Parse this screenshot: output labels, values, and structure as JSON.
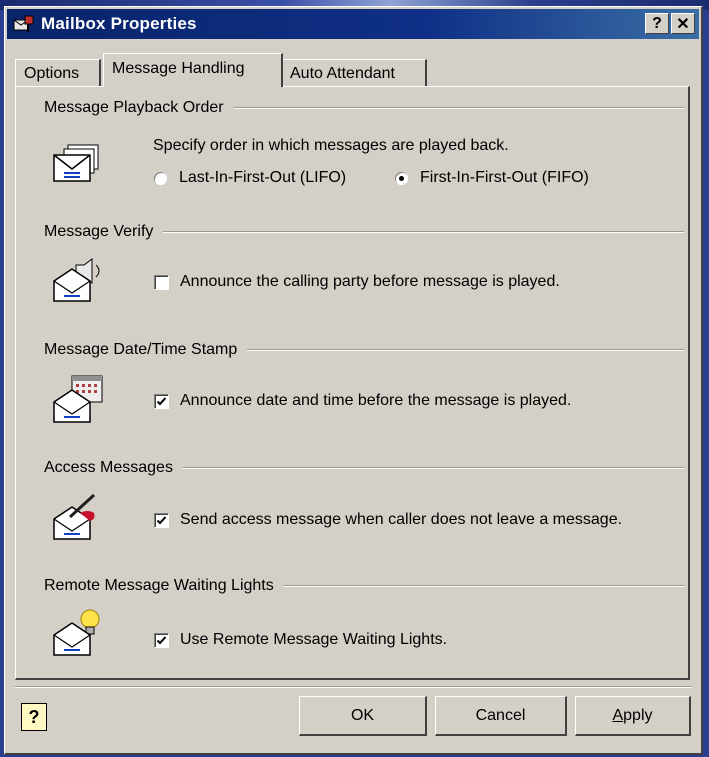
{
  "window": {
    "title": "Mailbox Properties",
    "help_glyph": "?",
    "close_glyph": "✕"
  },
  "tabs": [
    {
      "label": "Options",
      "active": false
    },
    {
      "label": "Message Handling",
      "active": true
    },
    {
      "label": "Auto Attendant",
      "active": false
    }
  ],
  "groups": {
    "playback_order": {
      "title": "Message Playback Order",
      "icon": "stacked-mail-envelope-icon",
      "description": "Specify order in which messages are played back.",
      "options": [
        {
          "label": "Last-In-First-Out (LIFO)",
          "selected": false
        },
        {
          "label": "First-In-First-Out (FIFO)",
          "selected": true
        }
      ]
    },
    "verify": {
      "title": "Message Verify",
      "icon": "speaker-envelope-icon",
      "checkbox_label": "Announce the calling party before message is played.",
      "checked": false
    },
    "date_time": {
      "title": "Message Date/Time Stamp",
      "icon": "calendar-envelope-icon",
      "checkbox_label": "Announce date and time before the message is played.",
      "checked": true
    },
    "access": {
      "title": "Access Messages",
      "icon": "pen-envelope-icon",
      "checkbox_label": "Send access message when caller does not leave a message.",
      "checked": true
    },
    "remote_lights": {
      "title": "Remote Message Waiting Lights",
      "icon": "lightbulb-envelope-icon",
      "checkbox_label": "Use Remote Message Waiting Lights.",
      "checked": true
    }
  },
  "buttons": {
    "help_glyph": "?",
    "ok": "OK",
    "cancel": "Cancel",
    "apply_first": "A",
    "apply_rest": "pply"
  },
  "colors": {
    "title_bar": "#0a246a",
    "face": "#d4d0c8",
    "highlight_bulb": "#ffe14a",
    "pen_red": "#c8102e"
  }
}
